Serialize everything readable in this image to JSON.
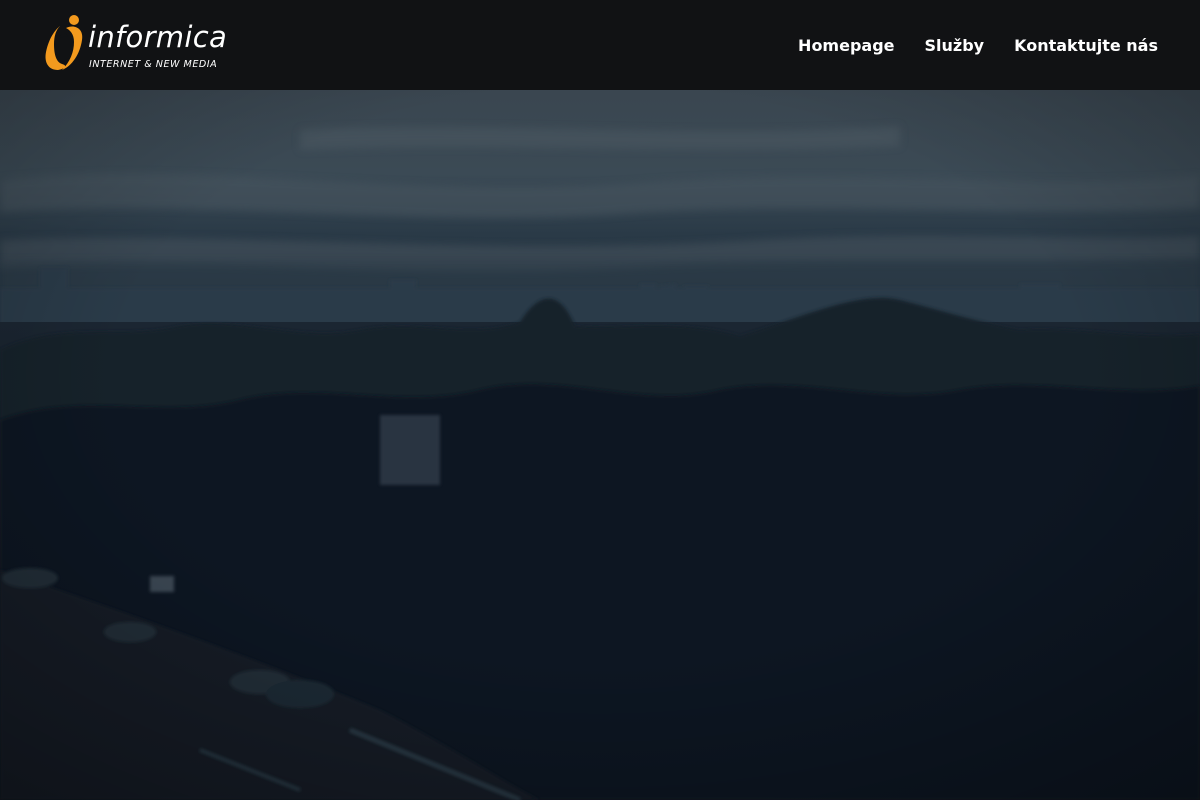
{
  "brand": {
    "name": "informica",
    "tagline": "INTERNET & NEW MEDIA",
    "accent_color": "#f39a1e"
  },
  "nav": {
    "items": [
      {
        "label": "Homepage"
      },
      {
        "label": "Služby"
      },
      {
        "label": "Kontaktujte nás"
      }
    ]
  },
  "colors": {
    "header_bg": "#111214",
    "nav_text": "#ffffff"
  }
}
